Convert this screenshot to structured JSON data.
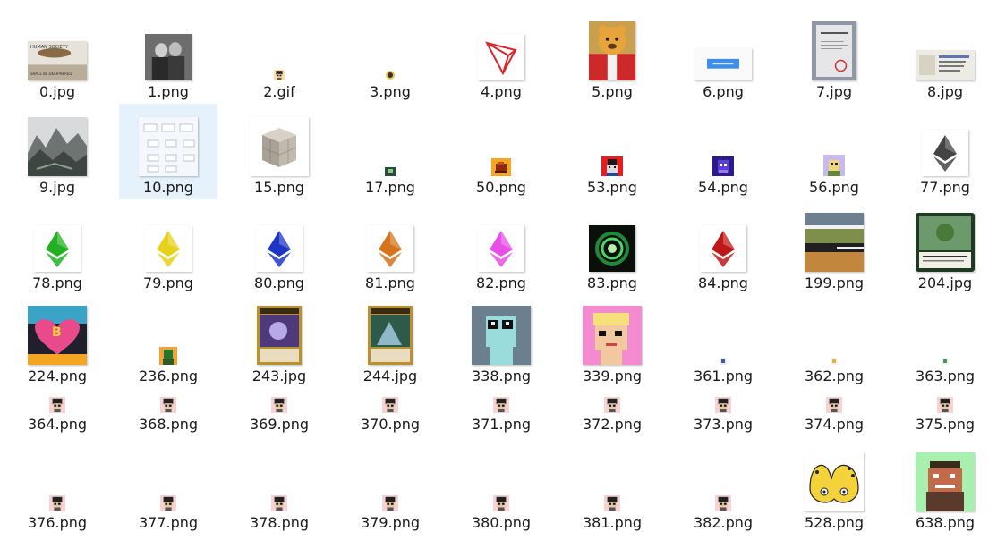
{
  "files": [
    {
      "name": "0.jpg",
      "thumb": "document-photo-thumbnail",
      "text": "HUMAN SOCIETY\nSHALL BE DECIPHERED"
    },
    {
      "name": "1.png",
      "thumb": "black-white-photo-thumbnail"
    },
    {
      "name": "2.gif",
      "thumb": "tiny-pixel-avatar-thumbnail"
    },
    {
      "name": "3.png",
      "thumb": "tiny-icon-thumbnail"
    },
    {
      "name": "4.png",
      "thumb": "tron-logo-thumbnail"
    },
    {
      "name": "5.png",
      "thumb": "portrait-bear-face-thumbnail"
    },
    {
      "name": "6.png",
      "thumb": "blue-button-screenshot-thumbnail"
    },
    {
      "name": "7.jpg",
      "thumb": "paper-document-photo-thumbnail"
    },
    {
      "name": "8.jpg",
      "thumb": "certificate-card-thumbnail"
    },
    {
      "name": "9.jpg",
      "thumb": "ink-landscape-painting-thumbnail"
    },
    {
      "name": "10.png",
      "thumb": "flowchart-diagram-thumbnail",
      "selected": true
    },
    {
      "name": "15.png",
      "thumb": "stone-cube-thumbnail"
    },
    {
      "name": "17.png",
      "thumb": "tiny-pixel-thumbnail"
    },
    {
      "name": "50.png",
      "thumb": "orange-pixel-art-thumbnail"
    },
    {
      "name": "53.png",
      "thumb": "red-pixel-character-thumbnail"
    },
    {
      "name": "54.png",
      "thumb": "purple-pixel-character-thumbnail"
    },
    {
      "name": "56.png",
      "thumb": "lavender-pixel-character-thumbnail"
    },
    {
      "name": "77.png",
      "thumb": "ethereum-gray-thumbnail",
      "color": "#444444"
    },
    {
      "name": "78.png",
      "thumb": "ethereum-green-thumbnail",
      "color": "#22b022"
    },
    {
      "name": "79.png",
      "thumb": "ethereum-yellow-thumbnail",
      "color": "#e6d21c"
    },
    {
      "name": "80.png",
      "thumb": "ethereum-blue-thumbnail",
      "color": "#1d36c8"
    },
    {
      "name": "81.png",
      "thumb": "ethereum-orange-thumbnail",
      "color": "#d5741d"
    },
    {
      "name": "82.png",
      "thumb": "ethereum-pink-thumbnail",
      "color": "#e84fe8"
    },
    {
      "name": "83.png",
      "thumb": "green-ring-pixel-thumbnail"
    },
    {
      "name": "84.png",
      "thumb": "ethereum-red-thumbnail",
      "color": "#c01818"
    },
    {
      "name": "199.png",
      "thumb": "striped-pixel-landscape-thumbnail"
    },
    {
      "name": "204.jpg",
      "thumb": "green-trading-card-thumbnail"
    },
    {
      "name": "224.png",
      "thumb": "bitcoin-pop-art-thumbnail"
    },
    {
      "name": "236.png",
      "thumb": "tiny-pixel-thumbnail"
    },
    {
      "name": "243.jpg",
      "thumb": "fantasy-card-thumbnail"
    },
    {
      "name": "244.jpg",
      "thumb": "fantasy-card-thumbnail"
    },
    {
      "name": "338.png",
      "thumb": "teal-pixel-face-thumbnail"
    },
    {
      "name": "339.png",
      "thumb": "pink-pixel-face-thumbnail"
    },
    {
      "name": "361.png",
      "thumb": "tiny-pixel-thumbnail"
    },
    {
      "name": "362.png",
      "thumb": "tiny-pixel-thumbnail"
    },
    {
      "name": "363.png",
      "thumb": "tiny-pixel-thumbnail"
    },
    {
      "name": "364.png",
      "thumb": "tiny-pixel-avatar-thumbnail"
    },
    {
      "name": "368.png",
      "thumb": "tiny-pixel-avatar-thumbnail"
    },
    {
      "name": "369.png",
      "thumb": "tiny-pixel-avatar-thumbnail"
    },
    {
      "name": "370.png",
      "thumb": "tiny-pixel-avatar-thumbnail"
    },
    {
      "name": "371.png",
      "thumb": "tiny-pixel-avatar-thumbnail"
    },
    {
      "name": "372.png",
      "thumb": "tiny-pixel-avatar-thumbnail"
    },
    {
      "name": "373.png",
      "thumb": "tiny-pixel-avatar-thumbnail"
    },
    {
      "name": "374.png",
      "thumb": "tiny-pixel-avatar-thumbnail"
    },
    {
      "name": "375.png",
      "thumb": "tiny-pixel-avatar-thumbnail"
    },
    {
      "name": "376.png",
      "thumb": "tiny-pixel-avatar-thumbnail"
    },
    {
      "name": "377.png",
      "thumb": "tiny-pixel-avatar-thumbnail"
    },
    {
      "name": "378.png",
      "thumb": "tiny-pixel-avatar-thumbnail"
    },
    {
      "name": "379.png",
      "thumb": "tiny-pixel-avatar-thumbnail"
    },
    {
      "name": "380.png",
      "thumb": "tiny-pixel-avatar-thumbnail"
    },
    {
      "name": "381.png",
      "thumb": "tiny-pixel-avatar-thumbnail"
    },
    {
      "name": "382.png",
      "thumb": "tiny-pixel-avatar-thumbnail"
    },
    {
      "name": "528.png",
      "thumb": "yellow-cartoon-thumbnail"
    },
    {
      "name": "638.png",
      "thumb": "green-pixel-character-thumbnail"
    }
  ]
}
